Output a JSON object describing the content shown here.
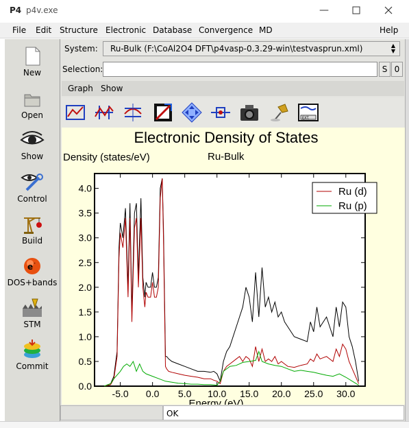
{
  "window": {
    "logo": "P4",
    "title": "p4v.exe"
  },
  "menu": [
    "File",
    "Edit",
    "Structure",
    "Electronic",
    "Database",
    "Convergence",
    "MD",
    "Help"
  ],
  "tools": [
    {
      "label": "New",
      "icon": "new-document-icon"
    },
    {
      "label": "Open",
      "icon": "folder-icon"
    },
    {
      "label": "Show",
      "icon": "eye-icon"
    },
    {
      "label": "Control",
      "icon": "wrench-icon"
    },
    {
      "label": "Build",
      "icon": "crane-icon"
    },
    {
      "label": "DOS+bands",
      "icon": "electron-icon"
    },
    {
      "label": "STM",
      "icon": "stm-tip-icon"
    },
    {
      "label": "Commit",
      "icon": "database-stack-icon"
    }
  ],
  "system": {
    "label": "System:",
    "value": "Ru-Bulk (F:\\CoAl2O4 DFT\\p4vasp-0.3.29-win\\testvasprun.xml)"
  },
  "selection": {
    "label": "Selection:",
    "value": "",
    "s_button": "S",
    "zero_button": "0"
  },
  "subtabs": [
    "Graph",
    "Show"
  ],
  "iconbar": [
    "zoom-rectangle-icon",
    "curve-select-icon",
    "shift-curve-icon",
    "axis-range-icon",
    "move-arrows-icon",
    "measure-icon",
    "camera-icon",
    "pin-icon",
    "export-icon"
  ],
  "status": {
    "message": "OK"
  },
  "chart_data": {
    "type": "line",
    "title": "Electronic Density of States",
    "subtitle": "Ru-Bulk",
    "xlabel": "Energy (eV)",
    "ylabel": "Density (states/eV)",
    "xlim": [
      -9,
      33
    ],
    "ylim": [
      0,
      4.3
    ],
    "xticks": [
      "-5.0",
      "0.0",
      "5.0",
      "10.0",
      "15.0",
      "20.0",
      "25.0",
      "30.0"
    ],
    "yticks": [
      "0.0",
      "0.5",
      "1.0",
      "1.5",
      "2.0",
      "2.5",
      "3.0",
      "3.5",
      "4.0"
    ],
    "xtick_values": [
      -5,
      0,
      5,
      10,
      15,
      20,
      25,
      30
    ],
    "ytick_values": [
      0,
      0.5,
      1.0,
      1.5,
      2.0,
      2.5,
      3.0,
      3.5,
      4.0
    ],
    "legend_position": "top-right",
    "series": [
      {
        "color": "#000000",
        "x": [
          -7.5,
          -6.5,
          -6.0,
          -5.5,
          -5.2,
          -5.0,
          -4.6,
          -4.2,
          -3.8,
          -3.5,
          -3.2,
          -2.8,
          -2.5,
          -2.2,
          -1.8,
          -1.5,
          -1.2,
          -1.0,
          -0.7,
          -0.3,
          0.0,
          0.3,
          0.6,
          0.9,
          1.2,
          1.5,
          1.7,
          2.0,
          2.2,
          2.5,
          3,
          4,
          5,
          6,
          7,
          8,
          9,
          9.5,
          10,
          10.5,
          11,
          11.5,
          12,
          13,
          13.5,
          14,
          14.5,
          15,
          15.5,
          16,
          16.5,
          17,
          17.5,
          18,
          18.5,
          19,
          19.5,
          20,
          20.5,
          21,
          22,
          23,
          24,
          24.5,
          25,
          25.5,
          26,
          27,
          28,
          28.5,
          29,
          29.5,
          30,
          30.5,
          31,
          31.5,
          32
        ],
        "y": [
          0.0,
          0.05,
          0.2,
          0.7,
          2.8,
          3.3,
          3.0,
          3.6,
          2.0,
          3.7,
          1.5,
          3.5,
          3.7,
          2.2,
          3.8,
          2.2,
          1.8,
          2.1,
          2.0,
          2.0,
          2.3,
          2.0,
          2.0,
          2.2,
          4.0,
          4.2,
          3.2,
          0.6,
          0.6,
          0.55,
          0.5,
          0.45,
          0.4,
          0.35,
          0.3,
          0.3,
          0.28,
          0.3,
          0.25,
          0.1,
          0.5,
          0.7,
          0.8,
          1.2,
          1.4,
          1.6,
          2.0,
          1.8,
          1.3,
          2.3,
          1.4,
          2.4,
          1.6,
          1.8,
          1.5,
          1.7,
          1.4,
          1.5,
          1.3,
          1.2,
          1.0,
          0.95,
          0.9,
          1.3,
          1.1,
          1.6,
          1.2,
          1.4,
          1.0,
          1.6,
          1.2,
          1.7,
          1.6,
          1.0,
          0.8,
          0.5,
          0.1
        ]
      },
      {
        "name": "Ru (d)",
        "color": "#b00000",
        "x": [
          -7.5,
          -6.5,
          -6.0,
          -5.5,
          -5.2,
          -5.0,
          -4.6,
          -4.2,
          -3.8,
          -3.5,
          -3.2,
          -2.8,
          -2.5,
          -2.2,
          -1.8,
          -1.5,
          -1.2,
          -1.0,
          -0.7,
          -0.3,
          0.0,
          0.3,
          0.6,
          0.9,
          1.2,
          1.5,
          1.7,
          2.0,
          2.2,
          2.5,
          3,
          4,
          5,
          6,
          7,
          8,
          9,
          9.5,
          10,
          10.5,
          11,
          11.5,
          12,
          13,
          13.5,
          14,
          14.5,
          15,
          15.5,
          16,
          16.5,
          17,
          17.5,
          18,
          18.5,
          19,
          19.5,
          20,
          20.5,
          21,
          22,
          23,
          24,
          24.5,
          25,
          25.5,
          26,
          27,
          28,
          28.5,
          29,
          29.5,
          30,
          30.5,
          31,
          31.5,
          32
        ],
        "y": [
          0.0,
          0.03,
          0.15,
          0.6,
          2.6,
          3.1,
          2.8,
          3.4,
          1.8,
          3.4,
          1.3,
          3.2,
          3.4,
          2.0,
          3.4,
          2.0,
          1.6,
          1.9,
          1.8,
          1.8,
          2.1,
          1.8,
          1.8,
          2.0,
          3.8,
          4.2,
          3.0,
          0.4,
          0.35,
          0.3,
          0.28,
          0.25,
          0.22,
          0.2,
          0.18,
          0.15,
          0.15,
          0.12,
          0.1,
          0.05,
          0.3,
          0.4,
          0.45,
          0.55,
          0.6,
          0.5,
          0.6,
          0.55,
          0.4,
          0.8,
          0.5,
          0.75,
          0.5,
          0.55,
          0.5,
          0.6,
          0.45,
          0.5,
          0.45,
          0.4,
          0.38,
          0.42,
          0.45,
          0.55,
          0.5,
          0.65,
          0.55,
          0.6,
          0.5,
          0.75,
          0.6,
          0.85,
          0.75,
          0.5,
          0.35,
          0.2,
          0.05
        ]
      },
      {
        "name": "Ru (p)",
        "color": "#00aa00",
        "x": [
          -7.5,
          -6.5,
          -6,
          -5,
          -4.5,
          -4,
          -3.5,
          -3,
          -2.5,
          -2,
          -1.5,
          -1,
          0,
          1,
          2,
          3,
          4,
          5,
          6,
          7,
          8,
          9,
          10,
          10.5,
          11,
          12,
          13,
          14,
          15,
          16,
          16.5,
          17,
          18,
          19,
          20,
          21,
          22,
          23,
          24,
          25,
          26,
          27,
          28,
          29,
          30,
          31,
          32
        ],
        "y": [
          0.0,
          0.05,
          0.15,
          0.3,
          0.4,
          0.45,
          0.4,
          0.5,
          0.3,
          0.45,
          0.3,
          0.25,
          0.2,
          0.15,
          0.1,
          0.08,
          0.06,
          0.05,
          0.04,
          0.04,
          0.03,
          0.03,
          0.02,
          0.1,
          0.3,
          0.4,
          0.42,
          0.48,
          0.5,
          0.52,
          0.7,
          0.5,
          0.45,
          0.42,
          0.4,
          0.35,
          0.3,
          0.32,
          0.3,
          0.28,
          0.25,
          0.22,
          0.2,
          0.25,
          0.18,
          0.1,
          0.02
        ]
      }
    ]
  }
}
